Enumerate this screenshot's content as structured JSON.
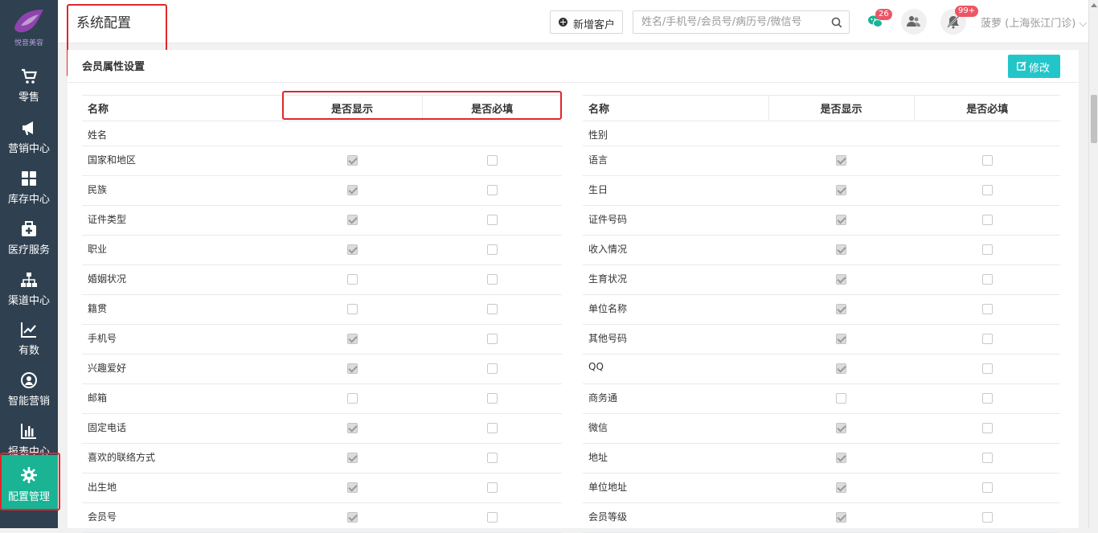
{
  "sidebar": {
    "logo_text": "悦音美容",
    "items": [
      {
        "label": "零售",
        "icon": "cart-icon"
      },
      {
        "label": "营销中心",
        "icon": "megaphone-icon"
      },
      {
        "label": "库存中心",
        "icon": "grid-icon"
      },
      {
        "label": "医疗服务",
        "icon": "medkit-icon"
      },
      {
        "label": "渠道中心",
        "icon": "sitemap-icon"
      },
      {
        "label": "有数",
        "icon": "line-chart-icon"
      },
      {
        "label": "智能营销",
        "icon": "user-circle-icon"
      },
      {
        "label": "报表中心",
        "icon": "bar-chart-icon"
      },
      {
        "label": "配置管理",
        "icon": "gear-icon",
        "active": true
      }
    ]
  },
  "header": {
    "title": "系统配置",
    "new_customer_label": "新增客户",
    "search_placeholder": "姓名/手机号/会员号/病历号/微信号",
    "wechat_badge": "26",
    "bell_badge": "99+",
    "user_label": "菠萝 (上海张江门诊) ⌵"
  },
  "section": {
    "title": "会员属性设置",
    "edit_label": "修改"
  },
  "columns": {
    "name": "名称",
    "show": "是否显示",
    "required": "是否必填"
  },
  "left_rows": [
    {
      "name": "姓名",
      "show": null,
      "required": null
    },
    {
      "name": "国家和地区",
      "show": true,
      "required": false
    },
    {
      "name": "民族",
      "show": true,
      "required": false
    },
    {
      "name": "证件类型",
      "show": true,
      "required": false
    },
    {
      "name": "职业",
      "show": true,
      "required": false
    },
    {
      "name": "婚姻状况",
      "show": false,
      "required": false
    },
    {
      "name": "籍贯",
      "show": false,
      "required": false
    },
    {
      "name": "手机号",
      "show": true,
      "required": false
    },
    {
      "name": "兴趣爱好",
      "show": true,
      "required": false
    },
    {
      "name": "邮箱",
      "show": false,
      "required": false
    },
    {
      "name": "固定电话",
      "show": true,
      "required": false
    },
    {
      "name": "喜欢的联络方式",
      "show": true,
      "required": false
    },
    {
      "name": "出生地",
      "show": true,
      "required": false
    },
    {
      "name": "会员号",
      "show": true,
      "required": false
    }
  ],
  "right_rows": [
    {
      "name": "性别",
      "show": null,
      "required": null
    },
    {
      "name": "语言",
      "show": true,
      "required": false
    },
    {
      "name": "生日",
      "show": true,
      "required": false
    },
    {
      "name": "证件号码",
      "show": true,
      "required": false
    },
    {
      "name": "收入情况",
      "show": true,
      "required": false
    },
    {
      "name": "生育状况",
      "show": true,
      "required": false
    },
    {
      "name": "单位名称",
      "show": true,
      "required": false
    },
    {
      "name": "其他号码",
      "show": true,
      "required": false
    },
    {
      "name": "QQ",
      "show": true,
      "required": false
    },
    {
      "name": "商务通",
      "show": false,
      "required": false
    },
    {
      "name": "微信",
      "show": true,
      "required": false
    },
    {
      "name": "地址",
      "show": true,
      "required": false
    },
    {
      "name": "单位地址",
      "show": true,
      "required": false
    },
    {
      "name": "会员等级",
      "show": true,
      "required": false
    }
  ]
}
